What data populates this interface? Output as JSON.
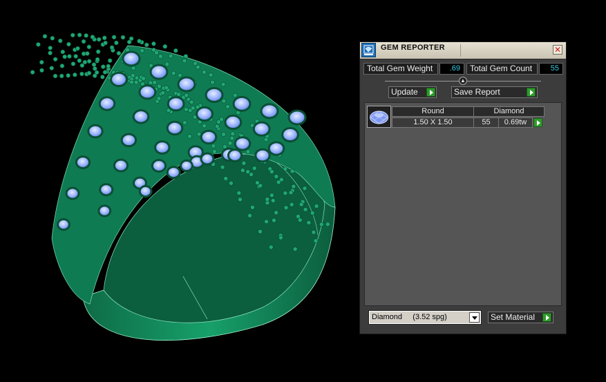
{
  "panel": {
    "title": "GEM REPORTER",
    "total_gem_weight_label": "Total Gem Weight",
    "total_gem_weight_value": ".69",
    "total_gem_count_label": "Total Gem Count",
    "total_gem_count_value": "55",
    "update_label": "Update",
    "save_report_label": "Save Report",
    "gem_list": [
      {
        "icon": "round-gem-icon",
        "shape": "Round",
        "material": "Diamond",
        "size": "1.50 X 1.50",
        "count": "55",
        "weight": "0.69tw"
      }
    ],
    "material_select": {
      "selected": "Diamond     (3.52 spg)"
    },
    "set_material_label": "Set Material"
  },
  "colors": {
    "metal": "#159462",
    "gem": "#9fb7ff",
    "panel_bg": "#3c3c3c",
    "value_text": "#3fd0e8",
    "accent_green": "#2f9b2c"
  }
}
